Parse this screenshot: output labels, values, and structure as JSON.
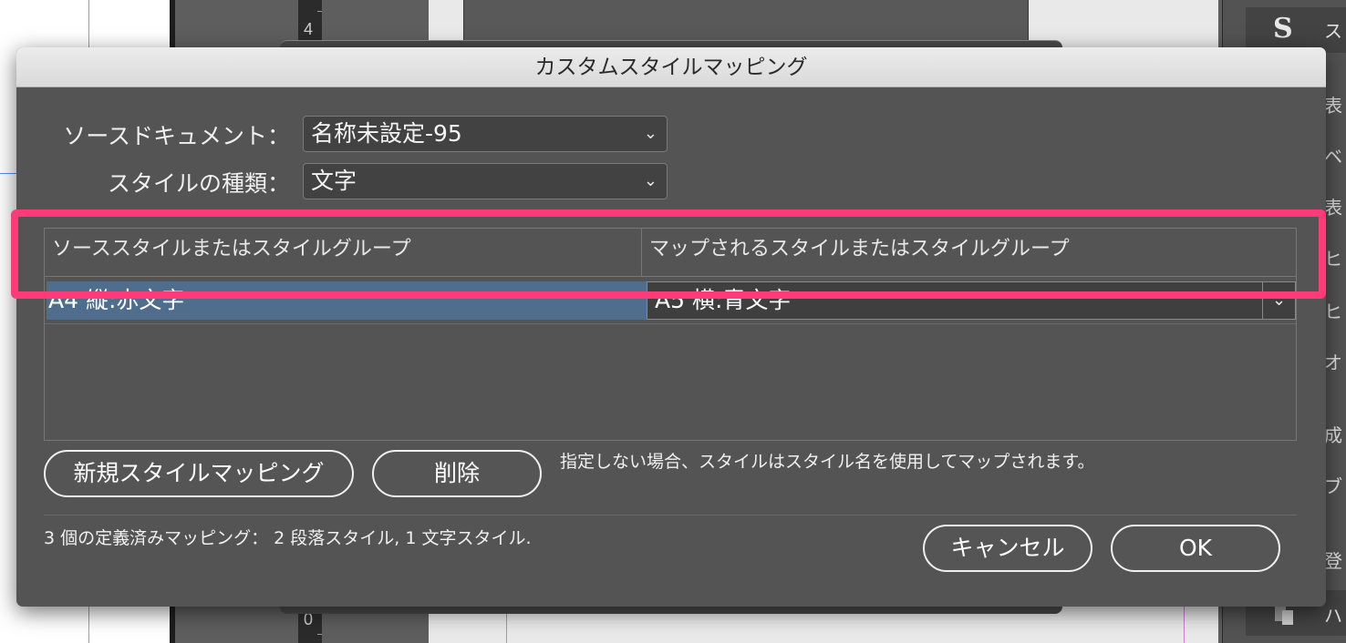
{
  "dialog": {
    "title": "カスタムスタイルマッピング",
    "source_document": {
      "label": "ソースドキュメント：",
      "value": "名称未設定-95"
    },
    "style_type": {
      "label": "スタイルの種類：",
      "value": "文字"
    },
    "table": {
      "headers": [
        "ソーススタイルまたはスタイルグループ",
        "マップされるスタイルまたはスタイルグループ"
      ],
      "rows": [
        {
          "source": "A4 縦:赤文字",
          "mapped": "A5 横:青文字",
          "selected": true
        }
      ]
    },
    "buttons": {
      "new_mapping": "新規スタイルマッピング",
      "delete": "削除",
      "cancel": "キャンセル",
      "ok": "OK"
    },
    "hint": "指定しない場合、スタイルはスタイル名を使用してマップされます。",
    "summary": "3 個の定義済みマッピング： 2 段落スタイル, 1 文字スタイル."
  },
  "background": {
    "ruler_numbers": [
      "4",
      "0"
    ],
    "panel_glyphs": [
      "ス",
      "表",
      "ベ",
      "表",
      "ヒ",
      "ヒ",
      "オ",
      "成",
      "ブ",
      "登",
      "ハ"
    ]
  },
  "icons": {
    "dropdown": "chevron-down-icon",
    "panel_logo": "script-s-icon",
    "panel_bottom": "pages-icon"
  },
  "colors": {
    "dialog_bg": "#545454",
    "selection": "#4f6d8c",
    "highlight": "#ff3a78"
  }
}
